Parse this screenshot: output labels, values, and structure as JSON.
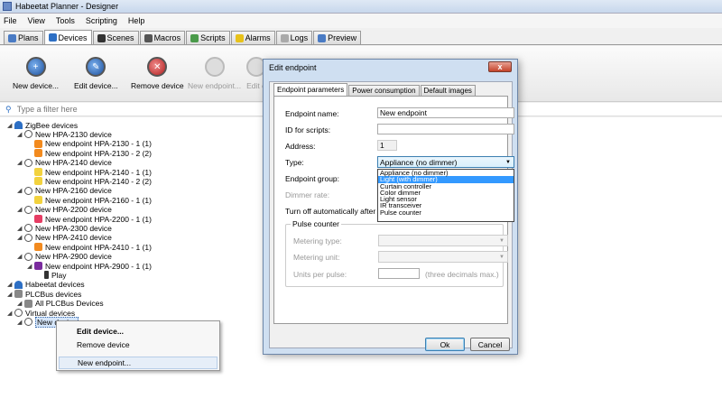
{
  "window": {
    "title": "Habeetat Planner - Designer"
  },
  "menu": [
    "File",
    "View",
    "Tools",
    "Scripting",
    "Help"
  ],
  "tabs": [
    {
      "label": "Plans",
      "icon": "plans-icon",
      "color": "#4a7bc4"
    },
    {
      "label": "Devices",
      "icon": "wifi-icon",
      "color": "#2d6fc4",
      "active": true
    },
    {
      "label": "Scenes",
      "icon": "scenes-icon",
      "color": "#333333"
    },
    {
      "label": "Macros",
      "icon": "macros-icon",
      "color": "#555555"
    },
    {
      "label": "Scripts",
      "icon": "scripts-icon",
      "color": "#4a9a4a"
    },
    {
      "label": "Alarms",
      "icon": "alarm-icon",
      "color": "#e8c21a"
    },
    {
      "label": "Logs",
      "icon": "logs-icon",
      "color": "#aaaaaa"
    },
    {
      "label": "Preview",
      "icon": "preview-icon",
      "color": "#4a7bc4"
    }
  ],
  "toolbar": {
    "new_device": "New device...",
    "edit_device": "Edit device...",
    "remove_device": "Remove device",
    "new_endpoint": "New endpoint...",
    "edit_endpoint": "Edit e"
  },
  "filter": {
    "placeholder": "Type a filter here"
  },
  "tree": [
    {
      "label": "ZigBee devices",
      "icon": "wifi",
      "indent": 0
    },
    {
      "label": "New HPA-2130 device",
      "icon": "dev",
      "indent": 1
    },
    {
      "label": "New endpoint HPA-2130 - 1 (1)",
      "icon": "ep",
      "indent": 2
    },
    {
      "label": "New endpoint HPA-2130 - 2 (2)",
      "icon": "ep",
      "indent": 2
    },
    {
      "label": "New HPA-2140 device",
      "icon": "dev",
      "indent": 1
    },
    {
      "label": "New endpoint HPA-2140 - 1 (1)",
      "icon": "light",
      "indent": 2
    },
    {
      "label": "New endpoint HPA-2140 - 2 (2)",
      "icon": "light",
      "indent": 2
    },
    {
      "label": "New HPA-2160 device",
      "icon": "dev",
      "indent": 1
    },
    {
      "label": "New endpoint HPA-2160 - 1 (1)",
      "icon": "light",
      "indent": 2
    },
    {
      "label": "New HPA-2200 device",
      "icon": "dev",
      "indent": 1
    },
    {
      "label": "New endpoint HPA-2200 - 1 (1)",
      "icon": "pink",
      "indent": 2
    },
    {
      "label": "New HPA-2300 device",
      "icon": "dev",
      "indent": 1
    },
    {
      "label": "New HPA-2410 device",
      "icon": "dev",
      "indent": 1
    },
    {
      "label": "New endpoint HPA-2410 - 1 (1)",
      "icon": "ep",
      "indent": 2
    },
    {
      "label": "New HPA-2900 device",
      "icon": "dev",
      "indent": 1
    },
    {
      "label": "New endpoint HPA-2900 - 1 (1)",
      "icon": "play",
      "indent": 2
    },
    {
      "label": "Play",
      "icon": "phone",
      "indent": 3
    },
    {
      "label": "Habeetat devices",
      "icon": "wifi",
      "indent": 0
    },
    {
      "label": "PLCBus devices",
      "icon": "plc",
      "indent": 0
    },
    {
      "label": "All PLCBus Devices",
      "icon": "plc",
      "indent": 1
    },
    {
      "label": "Virtual devices",
      "icon": "dev",
      "indent": 0
    },
    {
      "label": "New device",
      "icon": "dev",
      "indent": 1,
      "selected": true
    }
  ],
  "context_menu": {
    "edit_device": "Edit device...",
    "remove_device": "Remove device",
    "new_endpoint": "New endpoint..."
  },
  "dialog": {
    "title": "Edit endpoint",
    "close": "x",
    "tabs": [
      "Endpoint parameters",
      "Power consumption",
      "Default images"
    ],
    "endpoint_name_label": "Endpoint name:",
    "endpoint_name_value": "New endpoint",
    "id_label": "ID for scripts:",
    "id_value": "",
    "address_label": "Address:",
    "address_value": "1",
    "type_label": "Type:",
    "type_value": "Appliance (no dimmer)",
    "type_options": [
      "Appliance (no dimmer)",
      "Light (with dimmer)",
      "Curtain controller",
      "Color dimmer",
      "Light sensor",
      "IR transceiver",
      "Pulse counter"
    ],
    "type_highlighted": "Light (with dimmer)",
    "group_label": "Endpoint group:",
    "dimmer_label": "Dimmer rate:",
    "turnoff_label": "Turn off automatically after",
    "pulse_legend": "Pulse counter",
    "metering_type_label": "Metering type:",
    "metering_unit_label": "Metering unit:",
    "units_per_pulse_label": "Units per pulse:",
    "units_hint": "(three decimals max.)",
    "ok": "Ok",
    "cancel": "Cancel"
  }
}
